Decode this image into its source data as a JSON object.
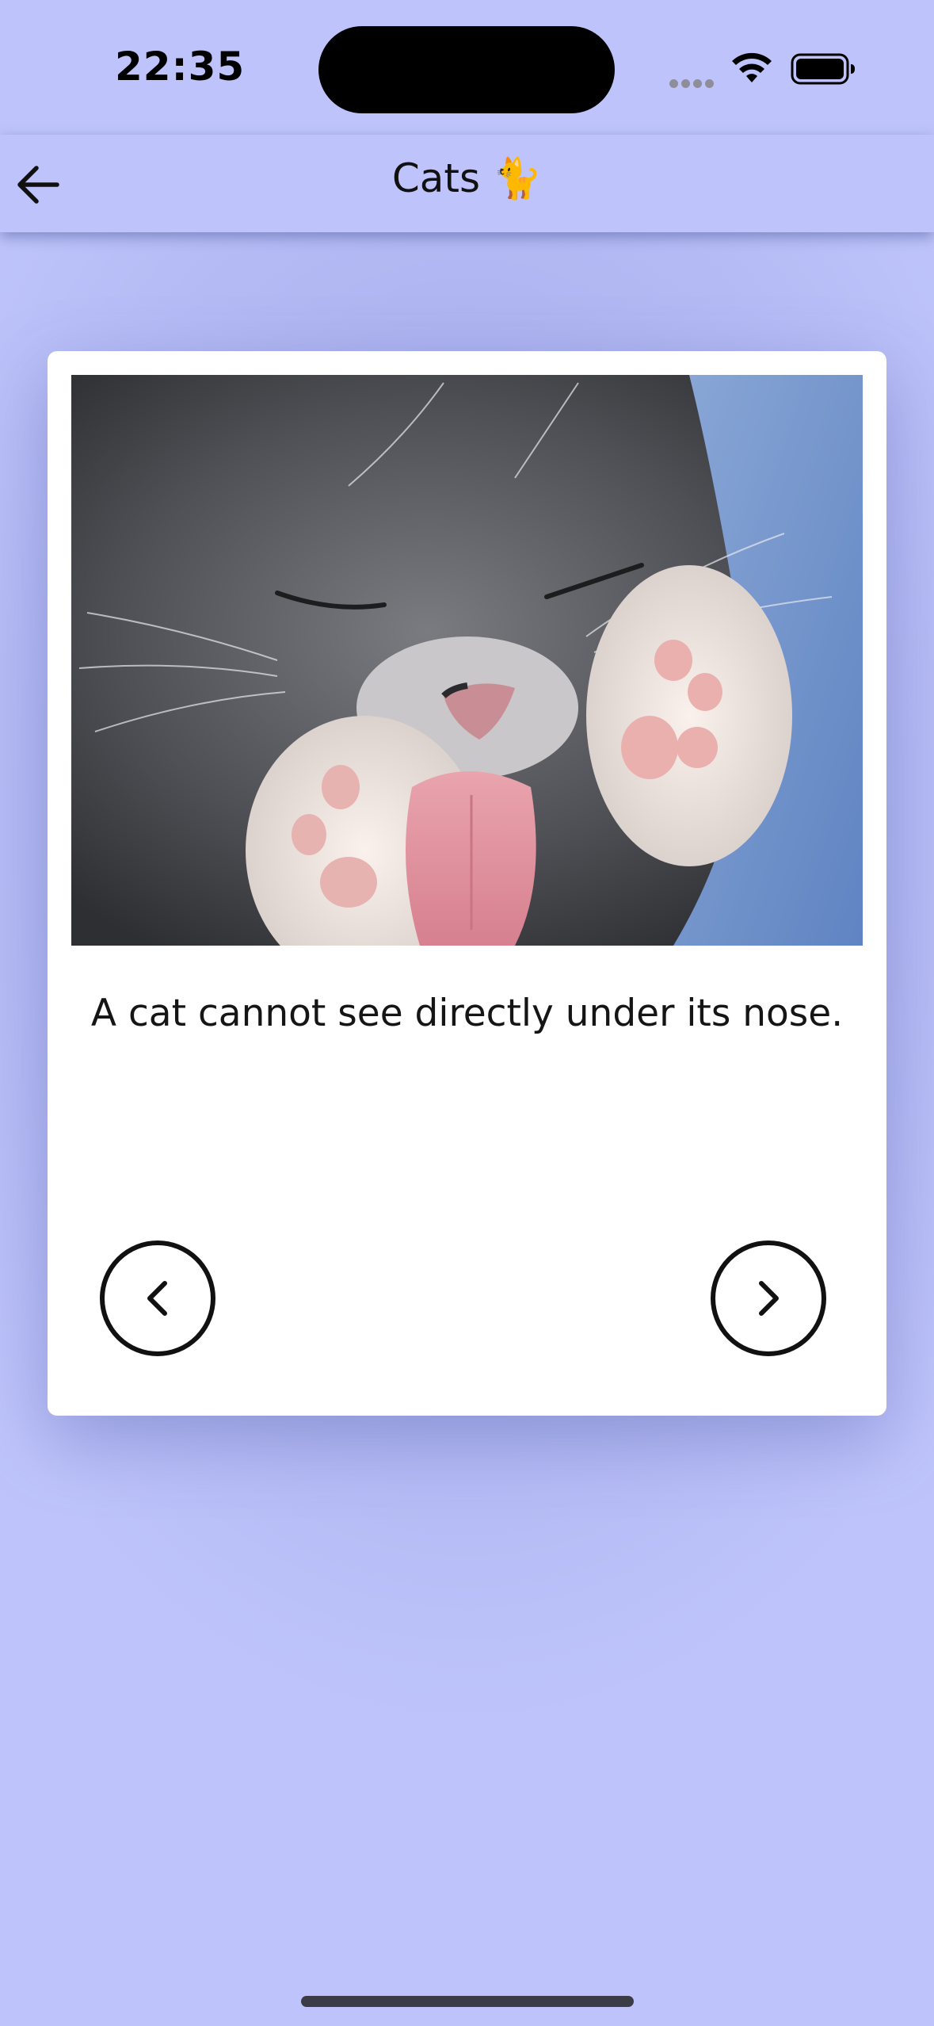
{
  "status_bar": {
    "time": "22:35"
  },
  "header": {
    "title": "Cats 🐈"
  },
  "card": {
    "image_subject": "kitten-licking-paw",
    "fact": "A cat cannot see directly under its nose."
  },
  "icons": {
    "back": "arrow-left-icon",
    "prev": "chevron-left-icon",
    "next": "chevron-right-icon"
  },
  "colors": {
    "background": "#bec4fb",
    "card": "#ffffff",
    "text": "#151515"
  }
}
